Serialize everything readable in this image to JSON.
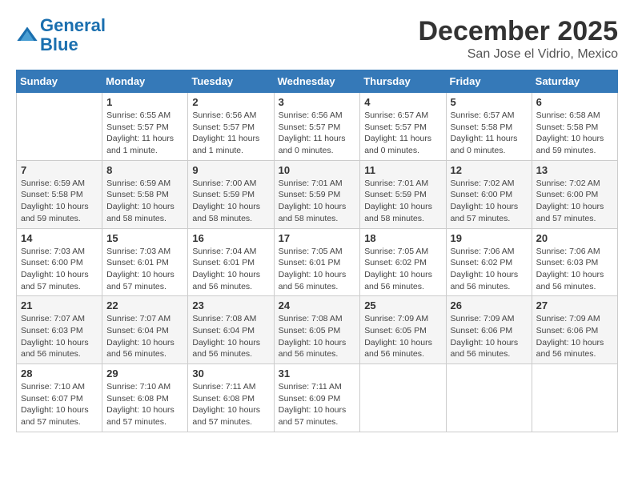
{
  "header": {
    "logo_line1": "General",
    "logo_line2": "Blue",
    "month_title": "December 2025",
    "location": "San Jose el Vidrio, Mexico"
  },
  "weekdays": [
    "Sunday",
    "Monday",
    "Tuesday",
    "Wednesday",
    "Thursday",
    "Friday",
    "Saturday"
  ],
  "weeks": [
    [
      {
        "day": "",
        "info": ""
      },
      {
        "day": "1",
        "info": "Sunrise: 6:55 AM\nSunset: 5:57 PM\nDaylight: 11 hours\nand 1 minute."
      },
      {
        "day": "2",
        "info": "Sunrise: 6:56 AM\nSunset: 5:57 PM\nDaylight: 11 hours\nand 1 minute."
      },
      {
        "day": "3",
        "info": "Sunrise: 6:56 AM\nSunset: 5:57 PM\nDaylight: 11 hours\nand 0 minutes."
      },
      {
        "day": "4",
        "info": "Sunrise: 6:57 AM\nSunset: 5:57 PM\nDaylight: 11 hours\nand 0 minutes."
      },
      {
        "day": "5",
        "info": "Sunrise: 6:57 AM\nSunset: 5:58 PM\nDaylight: 11 hours\nand 0 minutes."
      },
      {
        "day": "6",
        "info": "Sunrise: 6:58 AM\nSunset: 5:58 PM\nDaylight: 10 hours\nand 59 minutes."
      }
    ],
    [
      {
        "day": "7",
        "info": "Sunrise: 6:59 AM\nSunset: 5:58 PM\nDaylight: 10 hours\nand 59 minutes."
      },
      {
        "day": "8",
        "info": "Sunrise: 6:59 AM\nSunset: 5:58 PM\nDaylight: 10 hours\nand 58 minutes."
      },
      {
        "day": "9",
        "info": "Sunrise: 7:00 AM\nSunset: 5:59 PM\nDaylight: 10 hours\nand 58 minutes."
      },
      {
        "day": "10",
        "info": "Sunrise: 7:01 AM\nSunset: 5:59 PM\nDaylight: 10 hours\nand 58 minutes."
      },
      {
        "day": "11",
        "info": "Sunrise: 7:01 AM\nSunset: 5:59 PM\nDaylight: 10 hours\nand 58 minutes."
      },
      {
        "day": "12",
        "info": "Sunrise: 7:02 AM\nSunset: 6:00 PM\nDaylight: 10 hours\nand 57 minutes."
      },
      {
        "day": "13",
        "info": "Sunrise: 7:02 AM\nSunset: 6:00 PM\nDaylight: 10 hours\nand 57 minutes."
      }
    ],
    [
      {
        "day": "14",
        "info": "Sunrise: 7:03 AM\nSunset: 6:00 PM\nDaylight: 10 hours\nand 57 minutes."
      },
      {
        "day": "15",
        "info": "Sunrise: 7:03 AM\nSunset: 6:01 PM\nDaylight: 10 hours\nand 57 minutes."
      },
      {
        "day": "16",
        "info": "Sunrise: 7:04 AM\nSunset: 6:01 PM\nDaylight: 10 hours\nand 56 minutes."
      },
      {
        "day": "17",
        "info": "Sunrise: 7:05 AM\nSunset: 6:01 PM\nDaylight: 10 hours\nand 56 minutes."
      },
      {
        "day": "18",
        "info": "Sunrise: 7:05 AM\nSunset: 6:02 PM\nDaylight: 10 hours\nand 56 minutes."
      },
      {
        "day": "19",
        "info": "Sunrise: 7:06 AM\nSunset: 6:02 PM\nDaylight: 10 hours\nand 56 minutes."
      },
      {
        "day": "20",
        "info": "Sunrise: 7:06 AM\nSunset: 6:03 PM\nDaylight: 10 hours\nand 56 minutes."
      }
    ],
    [
      {
        "day": "21",
        "info": "Sunrise: 7:07 AM\nSunset: 6:03 PM\nDaylight: 10 hours\nand 56 minutes."
      },
      {
        "day": "22",
        "info": "Sunrise: 7:07 AM\nSunset: 6:04 PM\nDaylight: 10 hours\nand 56 minutes."
      },
      {
        "day": "23",
        "info": "Sunrise: 7:08 AM\nSunset: 6:04 PM\nDaylight: 10 hours\nand 56 minutes."
      },
      {
        "day": "24",
        "info": "Sunrise: 7:08 AM\nSunset: 6:05 PM\nDaylight: 10 hours\nand 56 minutes."
      },
      {
        "day": "25",
        "info": "Sunrise: 7:09 AM\nSunset: 6:05 PM\nDaylight: 10 hours\nand 56 minutes."
      },
      {
        "day": "26",
        "info": "Sunrise: 7:09 AM\nSunset: 6:06 PM\nDaylight: 10 hours\nand 56 minutes."
      },
      {
        "day": "27",
        "info": "Sunrise: 7:09 AM\nSunset: 6:06 PM\nDaylight: 10 hours\nand 56 minutes."
      }
    ],
    [
      {
        "day": "28",
        "info": "Sunrise: 7:10 AM\nSunset: 6:07 PM\nDaylight: 10 hours\nand 57 minutes."
      },
      {
        "day": "29",
        "info": "Sunrise: 7:10 AM\nSunset: 6:08 PM\nDaylight: 10 hours\nand 57 minutes."
      },
      {
        "day": "30",
        "info": "Sunrise: 7:11 AM\nSunset: 6:08 PM\nDaylight: 10 hours\nand 57 minutes."
      },
      {
        "day": "31",
        "info": "Sunrise: 7:11 AM\nSunset: 6:09 PM\nDaylight: 10 hours\nand 57 minutes."
      },
      {
        "day": "",
        "info": ""
      },
      {
        "day": "",
        "info": ""
      },
      {
        "day": "",
        "info": ""
      }
    ]
  ]
}
